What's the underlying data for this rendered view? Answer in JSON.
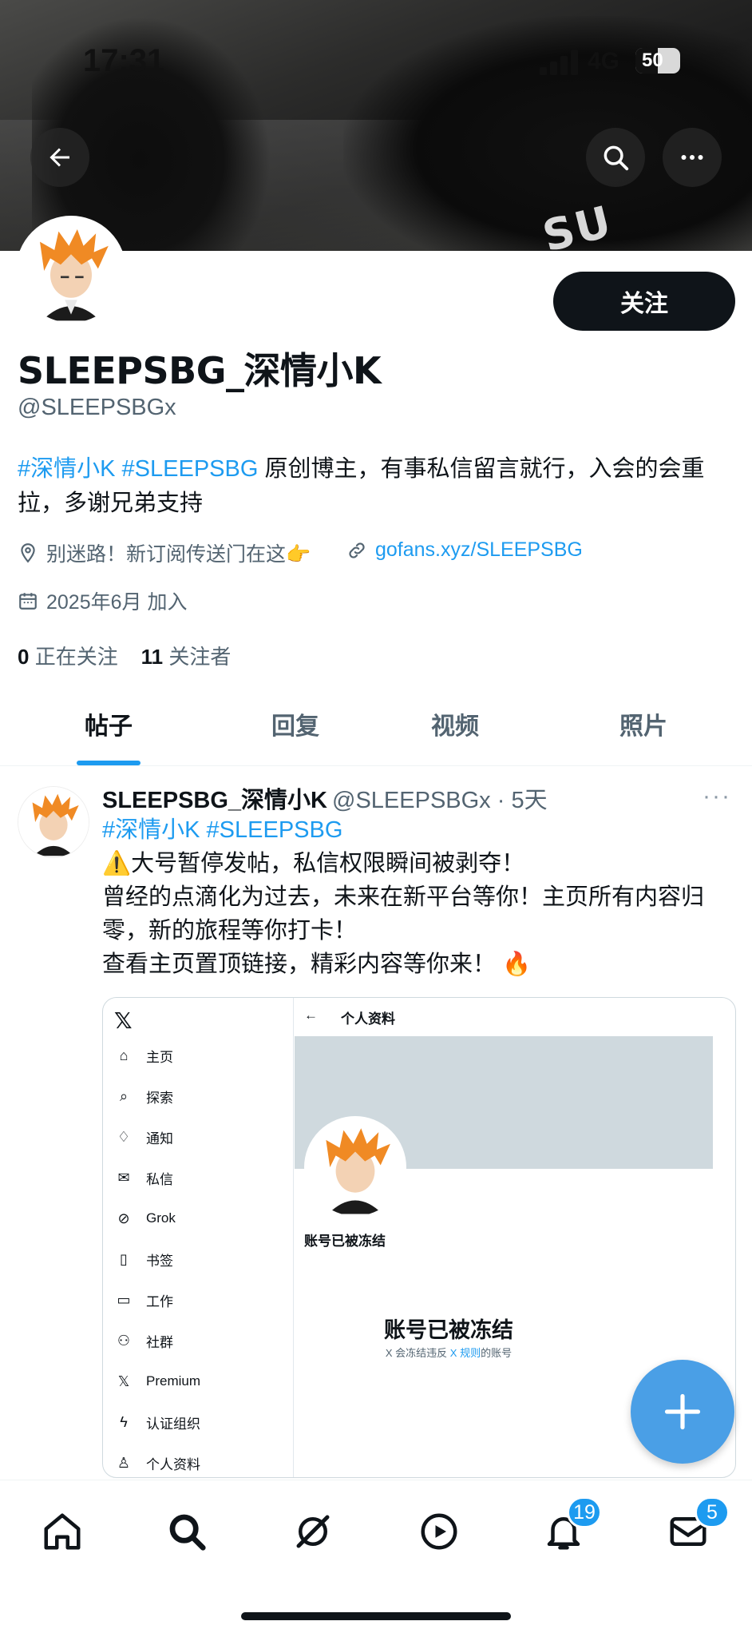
{
  "status_bar": {
    "time": "17:31",
    "network": "4G",
    "battery": "50",
    "battery_level": 0.5
  },
  "banner": {
    "bike_text": "SU"
  },
  "profile": {
    "follow_label": "关注",
    "display_name": "SLEEPSBG_深情小K",
    "handle": "@SLEEPSBGx",
    "bio": {
      "hashtags": "#深情小K #SLEEPSBG",
      "text": " 原创博主，有事私信留言就行，入会的会重拉，多谢兄弟支持"
    },
    "location": "别迷路！新订阅传送门在这👉",
    "website": "gofans.xyz/SLEEPSBG",
    "joined": "2025年6月 加入",
    "following_count": "0",
    "following_label": " 正在关注",
    "followers_count": "11",
    "followers_label": " 关注者"
  },
  "tabs": [
    {
      "label": "帖子",
      "active": true
    },
    {
      "label": "回复"
    },
    {
      "label": "视频"
    },
    {
      "label": "照片"
    }
  ],
  "post": {
    "name": "SLEEPSBG_深情小K",
    "handle_time": "@SLEEPSBGx · 5天",
    "more": "···",
    "lines": [
      {
        "text": "#深情小K #SLEEPSBG",
        "link": true
      },
      {
        "text": "⚠️大号暂停发帖，私信权限瞬间被剥夺！"
      },
      {
        "text": "曾经的点滴化为过去，未来在新平台等你！主页所有内容归"
      },
      {
        "text": "零，新的旅程等你打卡！"
      },
      {
        "text": "查看主页置顶链接，精彩内容等你来！ 🔥"
      }
    ],
    "embed": {
      "logo": "𝕏",
      "back_arrow": "←",
      "top_title": "个人资料",
      "nav": [
        {
          "label": "主页",
          "icon": "home-icon"
        },
        {
          "label": "探索",
          "icon": "search-icon"
        },
        {
          "label": "通知",
          "icon": "bell-icon"
        },
        {
          "label": "私信",
          "icon": "mail-icon"
        },
        {
          "label": "Grok",
          "icon": "grok-icon"
        },
        {
          "label": "书签",
          "icon": "bookmark-icon"
        },
        {
          "label": "工作",
          "icon": "briefcase-icon"
        },
        {
          "label": "社群",
          "icon": "people-icon"
        },
        {
          "label": "Premium",
          "icon": "x-icon"
        },
        {
          "label": "认证组织",
          "icon": "lightning-icon"
        },
        {
          "label": "个人资料",
          "icon": "person-icon"
        }
      ],
      "frozen_small": "账号已被冻结",
      "frozen_title": "账号已被冻结",
      "frozen_sub_prefix": "X 会冻结违反 ",
      "frozen_sub_link": "X 规则",
      "frozen_sub_suffix": "的账号"
    }
  },
  "bottom_nav": {
    "notifications_badge": "19",
    "messages_badge": "5"
  },
  "colors": {
    "accent": "#1d9bf0",
    "text": "#0f1419",
    "muted": "#536471",
    "fab": "#4a9fe6"
  }
}
